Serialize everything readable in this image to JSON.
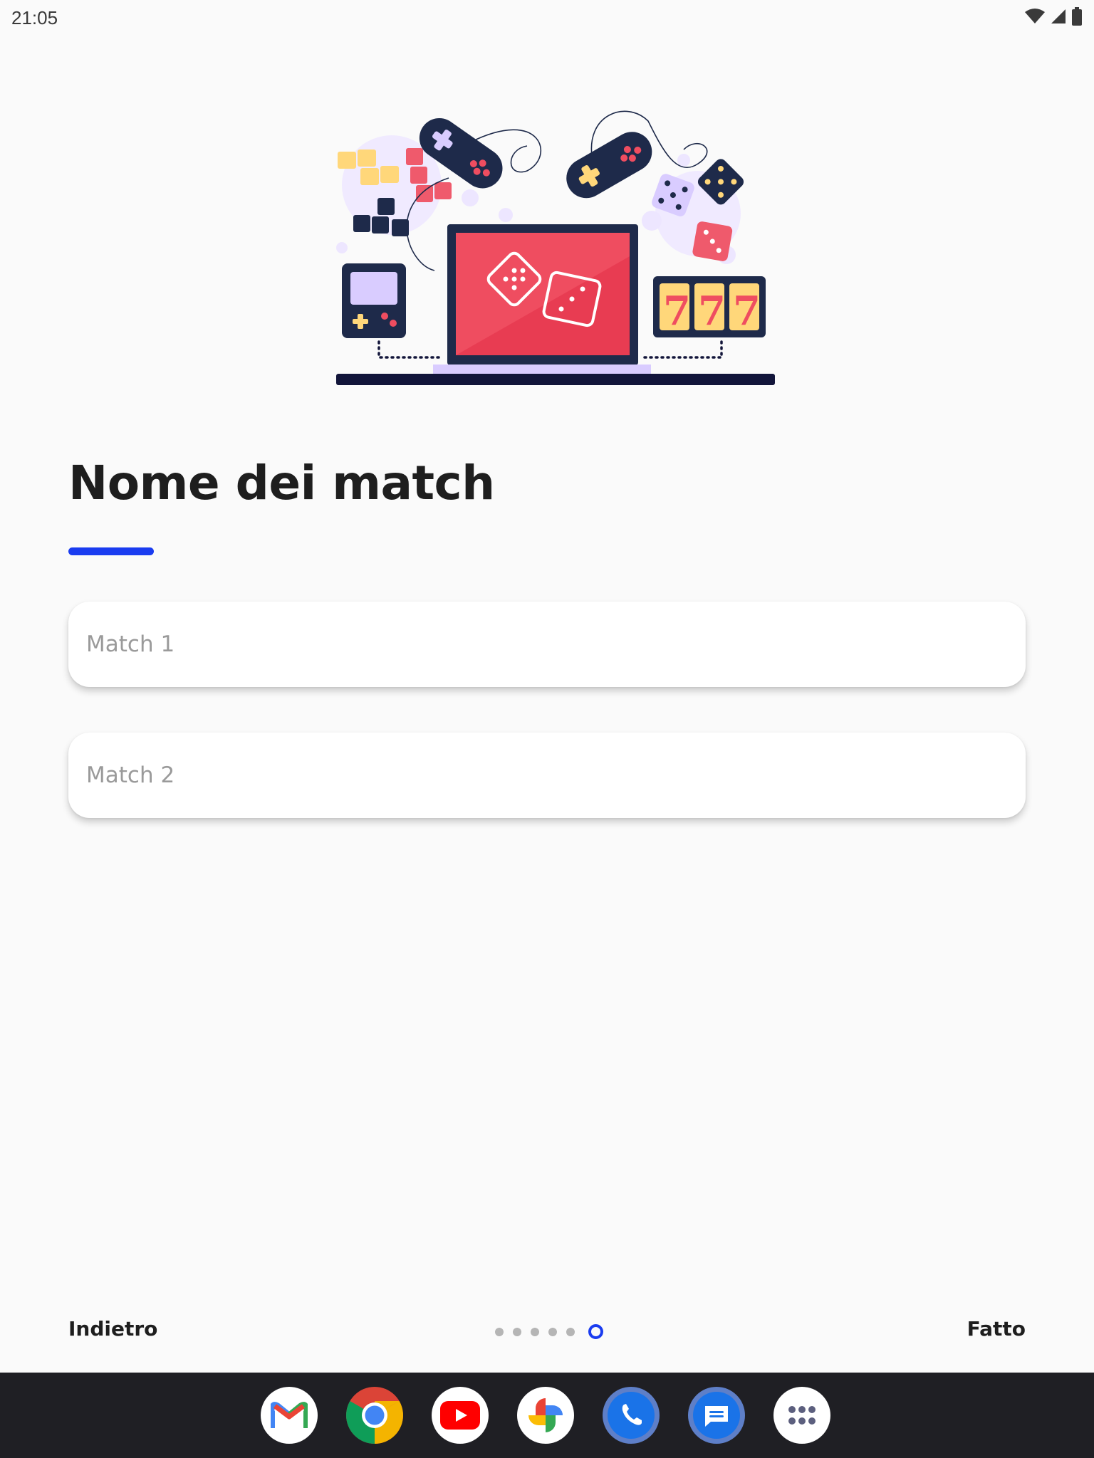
{
  "status_bar": {
    "time": "21:05"
  },
  "page": {
    "title": "Nome dei match"
  },
  "fields": [
    {
      "placeholder": "Match 1",
      "value": ""
    },
    {
      "placeholder": "Match 2",
      "value": ""
    }
  ],
  "navigation": {
    "back_label": "Indietro",
    "done_label": "Fatto",
    "page_count": 6,
    "current_page": 6
  },
  "dock": {
    "apps": [
      "gmail-icon",
      "chrome-icon",
      "youtube-icon",
      "photos-icon",
      "phone-icon",
      "messages-icon",
      "app-drawer-icon"
    ]
  },
  "colors": {
    "accent": "#1a3cf0",
    "background": "#fafafa",
    "taskbar": "#1f1f24",
    "illustration_red": "#ef4d60",
    "illustration_navy": "#1e2a4a",
    "illustration_yellow": "#ffd77a",
    "illustration_lavender": "#d9ccff"
  }
}
